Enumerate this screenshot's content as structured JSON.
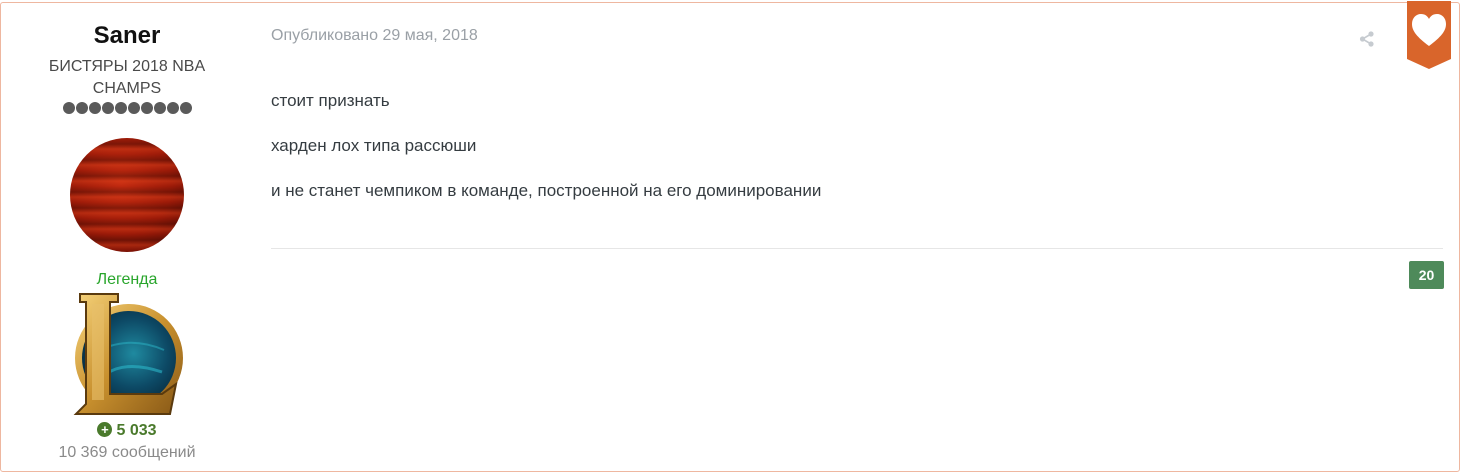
{
  "author": {
    "name": "Saner",
    "title": "БИСТЯРЫ 2018 NBA CHAMPS",
    "rank_pips": 10,
    "group": "Легенда",
    "reputation": "5 033",
    "post_count": "10 369 сообщений"
  },
  "post": {
    "date": "Опубликовано 29 мая, 2018",
    "paragraphs": [
      "стоит признать",
      "харден лох типа рассюши",
      "и не станет чемпиком в команде, построенной на его доминировании"
    ],
    "reaction_count": "20"
  },
  "icons": {
    "share": "share-icon",
    "reaction": "heart-icon",
    "reputation": "plus-circle-icon"
  },
  "colors": {
    "accent": "#d9652b",
    "rank_label": "#28a52b",
    "reputation": "#4a7a2c",
    "reaction_badge": "#4e8a5a"
  }
}
